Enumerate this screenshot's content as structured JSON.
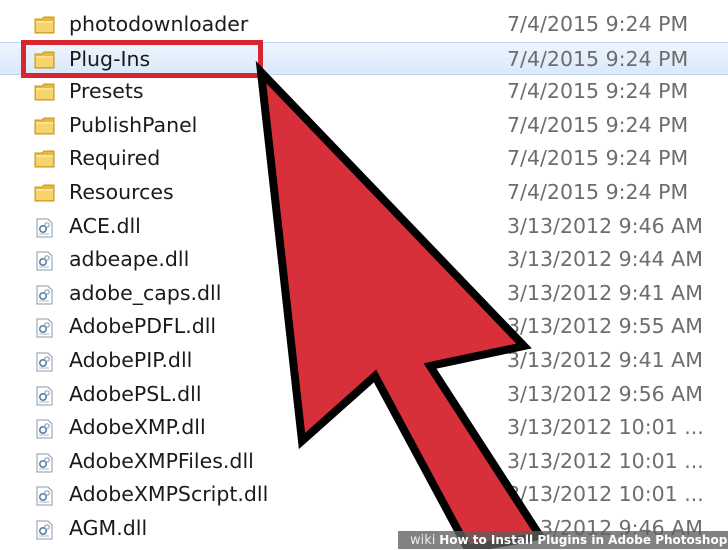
{
  "files": [
    {
      "name": "photodownloader",
      "date": "7/4/2015 9:24 PM",
      "icon": "folder-icon",
      "selected": false
    },
    {
      "name": "Plug-Ins",
      "date": "7/4/2015 9:24 PM",
      "icon": "folder-icon",
      "selected": true
    },
    {
      "name": "Presets",
      "date": "7/4/2015 9:24 PM",
      "icon": "folder-icon",
      "selected": false
    },
    {
      "name": "PublishPanel",
      "date": "7/4/2015 9:24 PM",
      "icon": "folder-icon",
      "selected": false
    },
    {
      "name": "Required",
      "date": "7/4/2015 9:24 PM",
      "icon": "folder-icon",
      "selected": false
    },
    {
      "name": "Resources",
      "date": "7/4/2015 9:24 PM",
      "icon": "folder-icon",
      "selected": false
    },
    {
      "name": "ACE.dll",
      "date": "3/13/2012 9:46 AM",
      "icon": "dll-file-icon",
      "selected": false
    },
    {
      "name": "adbeape.dll",
      "date": "3/13/2012 9:44 AM",
      "icon": "dll-file-icon",
      "selected": false
    },
    {
      "name": "adobe_caps.dll",
      "date": "3/13/2012 9:41 AM",
      "icon": "dll-file-icon",
      "selected": false
    },
    {
      "name": "AdobePDFL.dll",
      "date": "3/13/2012 9:55 AM",
      "icon": "dll-file-icon",
      "selected": false
    },
    {
      "name": "AdobePIP.dll",
      "date": "3/13/2012 9:41 AM",
      "icon": "dll-file-icon",
      "selected": false
    },
    {
      "name": "AdobePSL.dll",
      "date": "3/13/2012 9:56 AM",
      "icon": "dll-file-icon",
      "selected": false
    },
    {
      "name": "AdobeXMP.dll",
      "date": "3/13/2012 10:01 ...",
      "icon": "dll-file-icon",
      "selected": false
    },
    {
      "name": "AdobeXMPFiles.dll",
      "date": "3/13/2012 10:01 ...",
      "icon": "dll-file-icon",
      "selected": false
    },
    {
      "name": "AdobeXMPScript.dll",
      "date": "3/13/2012 10:01 ...",
      "icon": "dll-file-icon",
      "selected": false
    },
    {
      "name": "AGM.dll",
      "date": "3/13/2012 9:46 AM",
      "icon": "dll-file-icon",
      "selected": false
    }
  ],
  "annotation": {
    "color": "#d7262f",
    "target": "Plug-Ins"
  },
  "footer": {
    "brand": "wiki",
    "caption": "How to Install Plugins in Adobe Photoshop"
  }
}
